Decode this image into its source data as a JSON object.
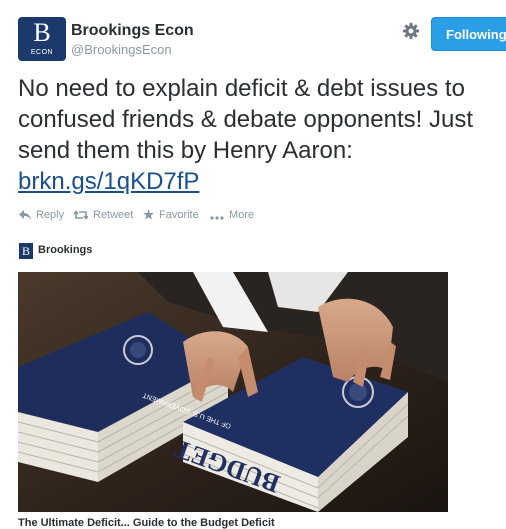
{
  "header": {
    "avatar_letter": "B",
    "avatar_sub": "ECON",
    "name": "Brookings Econ",
    "handle": "@BrookingsEcon",
    "follow_label": "Following"
  },
  "tweet": {
    "line1": "No need to explain deficit & debt issues to",
    "line2": "confused friends & debate opponents! Just",
    "line3": "send them this by Henry Aaron:",
    "link": "brkn.gs/1qKD7fP"
  },
  "actions": {
    "reply": "Reply",
    "retweet": "Retweet",
    "favorite": "Favorite",
    "more": "More"
  },
  "card": {
    "source_logo": "B",
    "source": "Brookings",
    "book_title": "BUDGET",
    "book_subtitle": "OF THE U.S. GOVERNMENT",
    "caption": "The Ultimate Deficit... Guide to the Budget Deficit"
  },
  "colors": {
    "brand": "#1b3a6b",
    "follow_button": "#2b9fe6",
    "link": "#1b4f8a",
    "muted": "#8899a6"
  }
}
